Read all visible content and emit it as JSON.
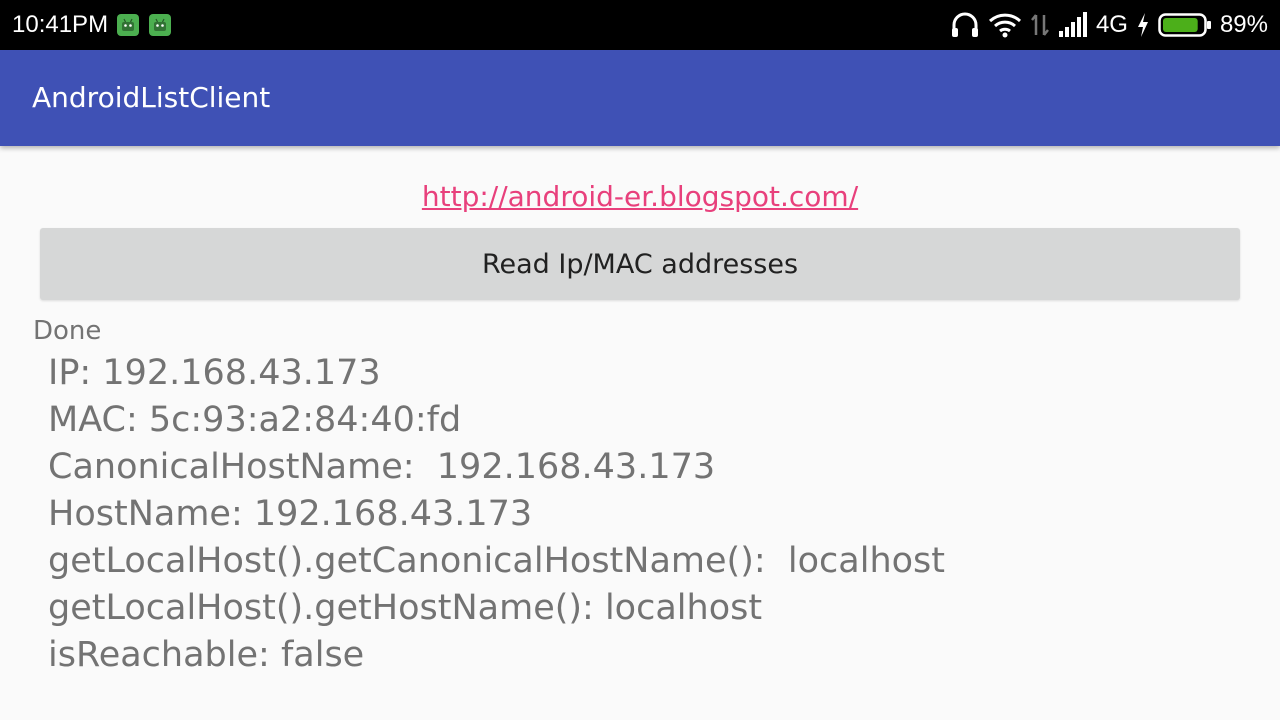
{
  "status_bar": {
    "time": "10:41PM",
    "network_type": "4G",
    "battery_percent": "89%",
    "battery_level": 0.89,
    "notification_icons": [
      "android-notification-icon",
      "android-notification-icon"
    ],
    "icons": [
      "headphones-icon",
      "wifi-icon",
      "data-transfer-icon",
      "signal-icon",
      "charging-icon",
      "battery-icon"
    ]
  },
  "app_bar": {
    "title": "AndroidListClient",
    "background_color": "#3f51b5"
  },
  "main": {
    "link": "http://android-er.blogspot.com/",
    "link_color": "#e8407c",
    "button_label": "Read Ip/MAC addresses",
    "status": "Done",
    "info_lines": [
      "IP: 192.168.43.173",
      "MAC: 5c:93:a2:84:40:fd",
      "CanonicalHostName:  192.168.43.173",
      "HostName: 192.168.43.173",
      "getLocalHost().getCanonicalHostName():  localhost",
      "getLocalHost().getHostName(): localhost",
      "isReachable: false"
    ]
  }
}
